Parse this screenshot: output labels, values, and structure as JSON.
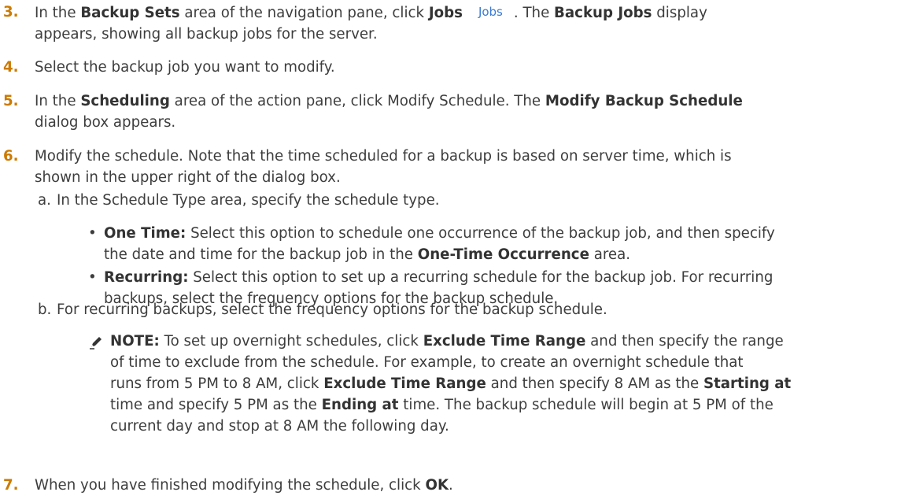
{
  "steps": {
    "s3": {
      "num": "3.",
      "p1": "In the ",
      "b1": "Backup Sets",
      "p2": " area of the navigation pane, click ",
      "b2": "Jobs",
      "icon_text": "Jobs",
      "p3": ". The ",
      "b3": "Backup Jobs",
      "p4": " display",
      "line2": "appears, showing all backup jobs for the server."
    },
    "s4": {
      "num": "4.",
      "text": "Select the backup job you want to modify."
    },
    "s5": {
      "num": "5.",
      "p1": "In the ",
      "b1": "Scheduling",
      "p2": " area of the action pane, click Modify Schedule. The ",
      "b2": "Modify Backup Schedule",
      "line2": "dialog box appears."
    },
    "s6": {
      "num": "6.",
      "line1": "Modify the schedule. Note that the time scheduled for a backup is based on server time, which is",
      "line2": "shown in the upper right of the dialog box.",
      "a": {
        "label": "a.",
        "text": "In the Schedule Type area, specify the schedule type."
      },
      "bullets": [
        {
          "bold": "One Time:",
          "l1": " Select this option to schedule one occurrence of the backup job, and then specify",
          "l2a": "the date and time for the backup job in the ",
          "l2b": "One-Time Occurrence",
          "l2c": " area."
        },
        {
          "bold": "Recurring:",
          "l1": " Select this option to set up a recurring schedule for the backup job. For recurring",
          "l2": "backups, select the frequency options for the backup schedule."
        }
      ],
      "b": {
        "label": "b.",
        "text": "For recurring backups, select the frequency options for the backup schedule."
      }
    },
    "note": {
      "icon": "pencil-icon",
      "l1a": "NOTE:",
      "l1b": " To set up overnight schedules, click ",
      "l1c": "Exclude Time Range",
      "l1d": " and then specify the range",
      "l2": "of time to exclude from the schedule. For example, to create an overnight schedule that",
      "l3a": "runs from 5 PM to 8 AM, click ",
      "l3b": "Exclude Time Range",
      "l3c": " and then specify 8 AM as the ",
      "l3d": "Starting at",
      "l4a": "time and specify 5 PM as the ",
      "l4b": "Ending at",
      "l4c": " time. The backup schedule will begin at 5 PM of the",
      "l5": "current day and stop at 8 AM the following day."
    },
    "s7": {
      "num": "7.",
      "p1": "When you have finished modifying the schedule, click ",
      "b1": "OK",
      "p2": "."
    }
  }
}
